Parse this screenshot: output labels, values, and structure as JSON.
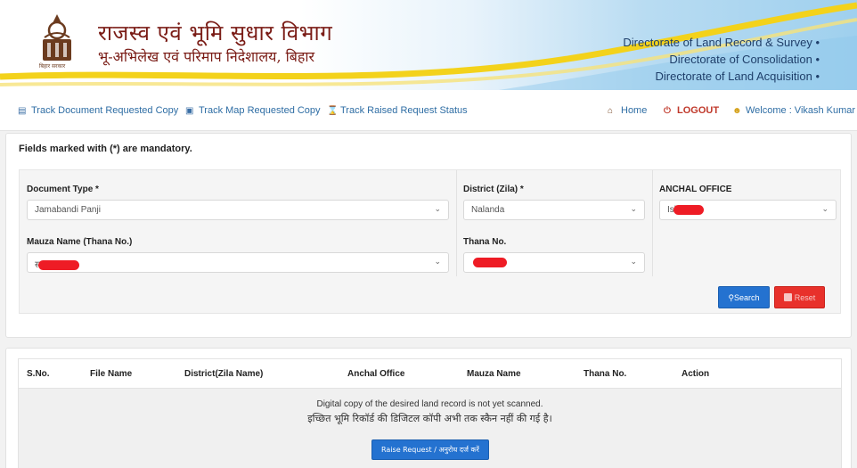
{
  "header": {
    "dept_title": "राजस्व एवं भूमि सुधार विभाग",
    "dept_subtitle": "भू-अभिलेख एवं परिमाप निदेशालय, बिहार",
    "emblem_caption": "बिहार सरकार",
    "directorates": [
      "Directorate of Land Record & Survey",
      "Directorate of Consolidation",
      "Directorate of Land Acquisition"
    ]
  },
  "nav": {
    "track_document": "Track Document Requested Copy",
    "track_map": "Track Map Requested Copy",
    "track_raised": "Track Raised Request Status",
    "home": "Home",
    "logout": "LOGOUT",
    "welcome": "Welcome : Vikash Kumar"
  },
  "form": {
    "mandatory_note": "Fields marked with (*) are mandatory.",
    "document_type": {
      "label": "Document Type *",
      "value": "Jamabandi Panji"
    },
    "district": {
      "label": "District (Zila) *",
      "value": "Nalanda"
    },
    "anchal": {
      "label": "ANCHAL OFFICE",
      "value": "Islam"
    },
    "mauza": {
      "label": "Mauza Name (Thana No.)",
      "value": "स"
    },
    "thana": {
      "label": "Thana No.",
      "value": ""
    },
    "search_label": "Search",
    "reset_label": "Reset"
  },
  "results": {
    "columns": [
      "S.No.",
      "File Name",
      "District(Zila Name)",
      "Anchal Office",
      "Mauza Name",
      "Thana No.",
      "Action"
    ],
    "message_en": "Digital copy of the desired land record is not yet scanned.",
    "message_hi": "इच्छित भूमि रिकॉर्ड की डिजिटल कॉपी अभी तक स्कैन नहीं की गई है।",
    "raise_request_label": "Raise Request / अनुरोध दर्ज करें"
  },
  "colors": {
    "accent_blue": "#2472d0",
    "reset_red": "#e8312b",
    "title_maroon": "#7a1c16",
    "redaction": "#ee1c25"
  }
}
